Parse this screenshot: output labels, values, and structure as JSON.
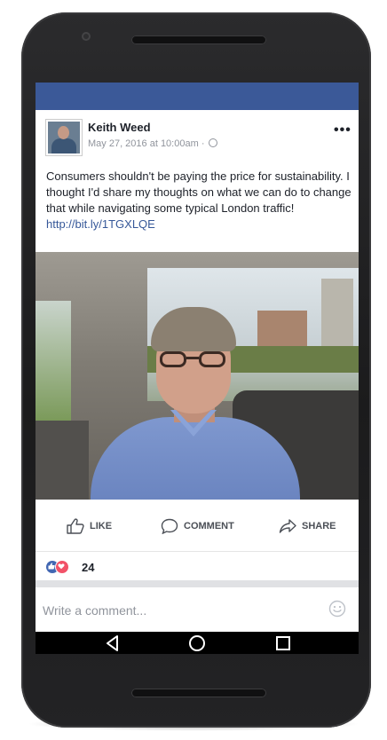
{
  "post": {
    "author": "Keith Weed",
    "timestamp": "May 27, 2016 at 10:00am",
    "separator": "·",
    "more_label": "•••",
    "text": "Consumers shouldn't be paying the price for sustainability. I thought I'd share my thoughts on what we can do to change that while navigating some typical London traffic!",
    "link": "http://bit.ly/1TGXLQE"
  },
  "actions": {
    "like": "LIKE",
    "comment": "COMMENT",
    "share": "SHARE"
  },
  "reactions": {
    "count": "24",
    "types": [
      "like",
      "love"
    ]
  },
  "comment_box": {
    "placeholder": "Write a comment..."
  },
  "icons": {
    "privacy": "globe-icon",
    "like": "thumbs-up-icon",
    "comment": "speech-bubble-icon",
    "share": "share-arrow-icon",
    "emoji": "smiley-icon",
    "nav": [
      "back-triangle-icon",
      "home-circle-icon",
      "recents-square-icon"
    ]
  },
  "colors": {
    "facebook_blue": "#3b5998",
    "link": "#365899",
    "like_reaction": "#4267b2",
    "love_reaction": "#f25268"
  }
}
